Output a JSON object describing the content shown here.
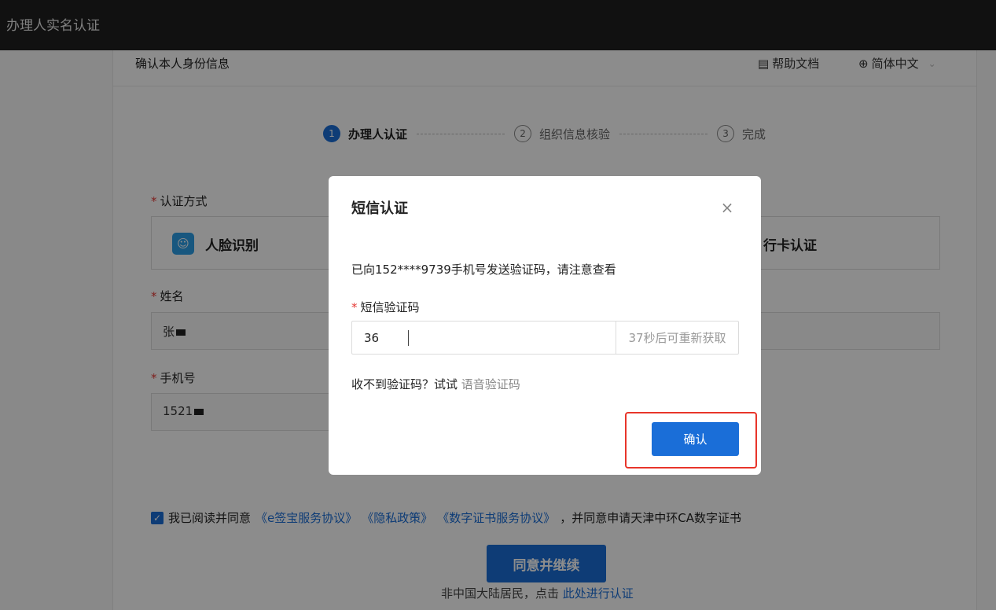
{
  "app": {
    "title": "办理人实名认证"
  },
  "header": {
    "page_title": "确认本人身份信息",
    "help_label": "帮助文档",
    "language": "简体中文"
  },
  "steps": [
    {
      "num": "1",
      "label": "办理人认证"
    },
    {
      "num": "2",
      "label": "组织信息核验"
    },
    {
      "num": "3",
      "label": "完成"
    }
  ],
  "form": {
    "method_label": "认证方式",
    "method_face": "人脸识别",
    "method_bank": "行卡认证",
    "name_label": "姓名",
    "name_value": "张",
    "phone_label": "手机号",
    "phone_value": "1521"
  },
  "agreement": {
    "prefix": "我已阅读并同意",
    "links": [
      "《e签宝服务协议》",
      "《隐私政策》",
      "《数字证书服务协议》"
    ],
    "suffix": "，并同意申请天津中环CA数字证书"
  },
  "continue_label": "同意并继续",
  "foreign": {
    "text": "非中国大陆居民，点击",
    "link": "此处进行认证"
  },
  "modal": {
    "title": "短信认证",
    "sent_text": "已向152****9739手机号发送验证码，请注意查看",
    "code_label": "短信验证码",
    "code_value": "36",
    "resend": "37秒后可重新获取",
    "no_receive": "收不到验证码？试试",
    "voice_link": "语音验证码",
    "confirm": "确认"
  },
  "colors": {
    "primary": "#1a6ed8",
    "highlight": "#e8352a",
    "required": "#e53935"
  }
}
